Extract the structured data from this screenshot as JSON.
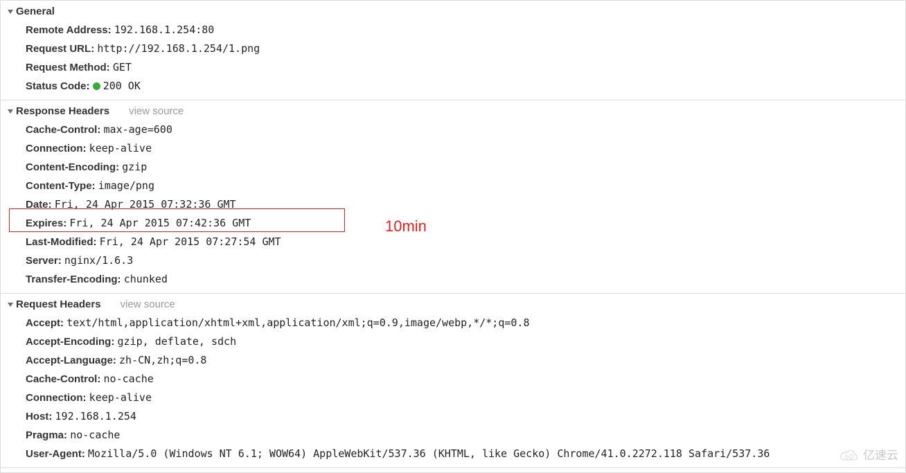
{
  "general": {
    "title": "General",
    "rows": [
      {
        "label": "Remote Address",
        "value": "192.168.1.254:80"
      },
      {
        "label": "Request URL",
        "value": "http://192.168.1.254/1.png"
      },
      {
        "label": "Request Method",
        "value": "GET"
      },
      {
        "label": "Status Code",
        "value": "200 OK",
        "status_dot": true
      }
    ]
  },
  "response": {
    "title": "Response Headers",
    "view_source": "view source",
    "rows": [
      {
        "label": "Cache-Control",
        "value": "max-age=600"
      },
      {
        "label": "Connection",
        "value": "keep-alive"
      },
      {
        "label": "Content-Encoding",
        "value": "gzip"
      },
      {
        "label": "Content-Type",
        "value": "image/png"
      },
      {
        "label": "Date",
        "value": "Fri, 24 Apr 2015 07:32:36 GMT"
      },
      {
        "label": "Expires",
        "value": "Fri, 24 Apr 2015 07:42:36 GMT"
      },
      {
        "label": "Last-Modified",
        "value": "Fri, 24 Apr 2015 07:27:54 GMT"
      },
      {
        "label": "Server",
        "value": "nginx/1.6.3"
      },
      {
        "label": "Transfer-Encoding",
        "value": "chunked"
      }
    ]
  },
  "request": {
    "title": "Request Headers",
    "view_source": "view source",
    "rows": [
      {
        "label": "Accept",
        "value": "text/html,application/xhtml+xml,application/xml;q=0.9,image/webp,*/*;q=0.8"
      },
      {
        "label": "Accept-Encoding",
        "value": "gzip, deflate, sdch"
      },
      {
        "label": "Accept-Language",
        "value": "zh-CN,zh;q=0.8"
      },
      {
        "label": "Cache-Control",
        "value": "no-cache"
      },
      {
        "label": "Connection",
        "value": "keep-alive"
      },
      {
        "label": "Host",
        "value": "192.168.1.254"
      },
      {
        "label": "Pragma",
        "value": "no-cache"
      },
      {
        "label": "User-Agent",
        "value": "Mozilla/5.0 (Windows NT 6.1; WOW64) AppleWebKit/537.36 (KHTML, like Gecko) Chrome/41.0.2272.118 Safari/537.36"
      }
    ]
  },
  "annotation": {
    "text": "10min"
  },
  "watermark": {
    "text": "亿速云"
  }
}
